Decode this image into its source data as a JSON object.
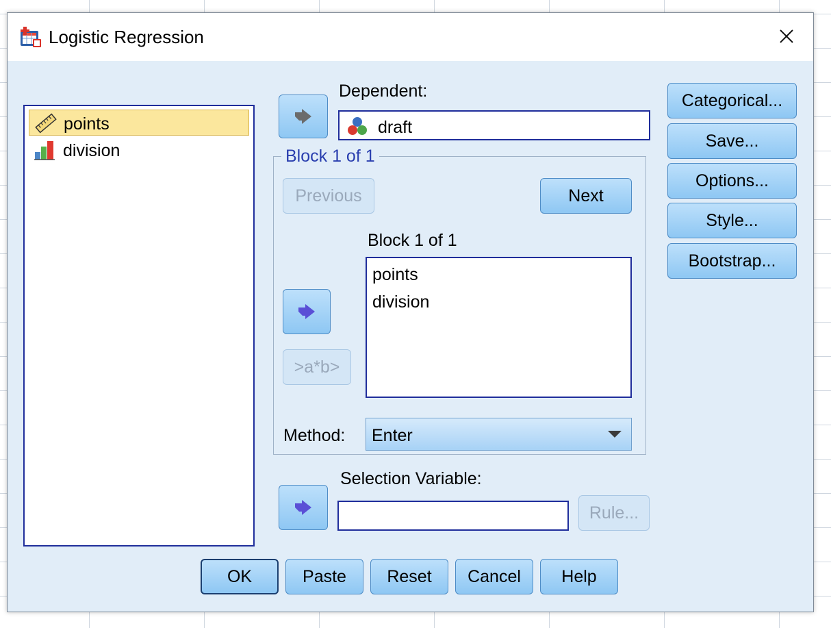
{
  "window": {
    "title": "Logistic Regression"
  },
  "variables": {
    "items": [
      {
        "label": "points",
        "icon": "ruler-scale-icon",
        "selected": true
      },
      {
        "label": "division",
        "icon": "bar-chart-icon",
        "selected": false
      }
    ]
  },
  "dependent": {
    "label": "Dependent:",
    "value": "draft",
    "icon": "nominal-variable-icon"
  },
  "block": {
    "group_title": "Block 1 of 1",
    "previous_label": "Previous",
    "next_label": "Next",
    "list_title": "Block 1 of 1",
    "items": [
      "points",
      "division"
    ],
    "interaction_label": ">a*b>"
  },
  "method": {
    "label": "Method:",
    "value": "Enter"
  },
  "selection": {
    "label": "Selection Variable:",
    "value": "",
    "rule_label": "Rule..."
  },
  "side_buttons": {
    "categorical": "Categorical...",
    "save": "Save...",
    "options": "Options...",
    "style": "Style...",
    "bootstrap": "Bootstrap..."
  },
  "bottom_buttons": {
    "ok": "OK",
    "paste": "Paste",
    "reset": "Reset",
    "cancel": "Cancel",
    "help": "Help"
  },
  "colors": {
    "accent": "#1f2d9b",
    "button_top": "#bde0fb",
    "button_bottom": "#8ec7f3",
    "selection": "#fbe79d"
  }
}
